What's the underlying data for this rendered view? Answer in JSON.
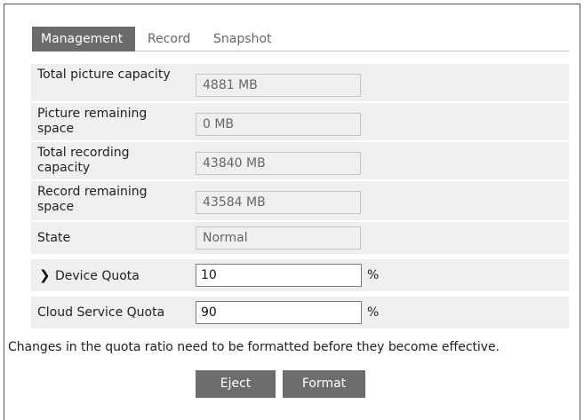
{
  "tabs": [
    {
      "label": "Management"
    },
    {
      "label": "Record"
    },
    {
      "label": "Snapshot"
    }
  ],
  "fields": {
    "total_picture_capacity": {
      "label": "Total picture capacity",
      "value": "4881 MB"
    },
    "picture_remaining_space": {
      "label": "Picture remaining space",
      "value": "0 MB"
    },
    "total_recording_capacity": {
      "label": "Total recording capacity",
      "value": "43840 MB"
    },
    "record_remaining_space": {
      "label": "Record remaining space",
      "value": "43584 MB"
    },
    "state": {
      "label": "State",
      "value": "Normal"
    }
  },
  "quota": {
    "device": {
      "label": "Device Quota",
      "value": "10",
      "unit": "%",
      "expand_icon": "chevron-right-icon"
    },
    "cloud": {
      "label": "Cloud Service Quota",
      "value": "90",
      "unit": "%"
    }
  },
  "notice": "Changes in the quota ratio need to be formatted before they become effective.",
  "buttons": {
    "eject": "Eject",
    "format": "Format"
  },
  "colors": {
    "tab_active_bg": "#6b6b6b",
    "button_bg": "#6d6d6d",
    "row_bg": "#efefef"
  }
}
